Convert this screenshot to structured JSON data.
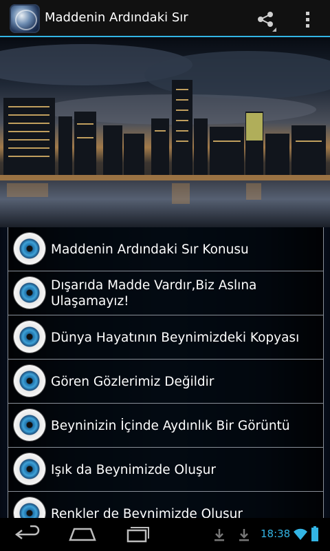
{
  "app": {
    "title": "Maddenin Ardındaki Sır",
    "icon": "app-logo-icon"
  },
  "actions": {
    "share_icon": "share-icon",
    "overflow_icon": "overflow-menu-icon"
  },
  "list": {
    "items": [
      {
        "label": "Maddenin Ardındaki Sır Konusu",
        "icon": "eye-icon"
      },
      {
        "label": "Dışarıda Madde Vardır,Biz Aslına Ulaşamayız!",
        "icon": "eye-icon"
      },
      {
        "label": "Dünya Hayatının Beynimizdeki Kopyası",
        "icon": "eye-icon"
      },
      {
        "label": "Gören Gözlerimiz Değildir",
        "icon": "eye-icon"
      },
      {
        "label": "Beyninizin İçinde Aydınlık Bir Görüntü",
        "icon": "eye-icon"
      },
      {
        "label": "Işık da Beynimizde Oluşur",
        "icon": "eye-icon"
      },
      {
        "label": "Renkler de Beynimizde Oluşur",
        "icon": "eye-icon"
      }
    ]
  },
  "status": {
    "time": "18:38"
  },
  "colors": {
    "accent": "#33b5e5",
    "background": "#000000"
  }
}
